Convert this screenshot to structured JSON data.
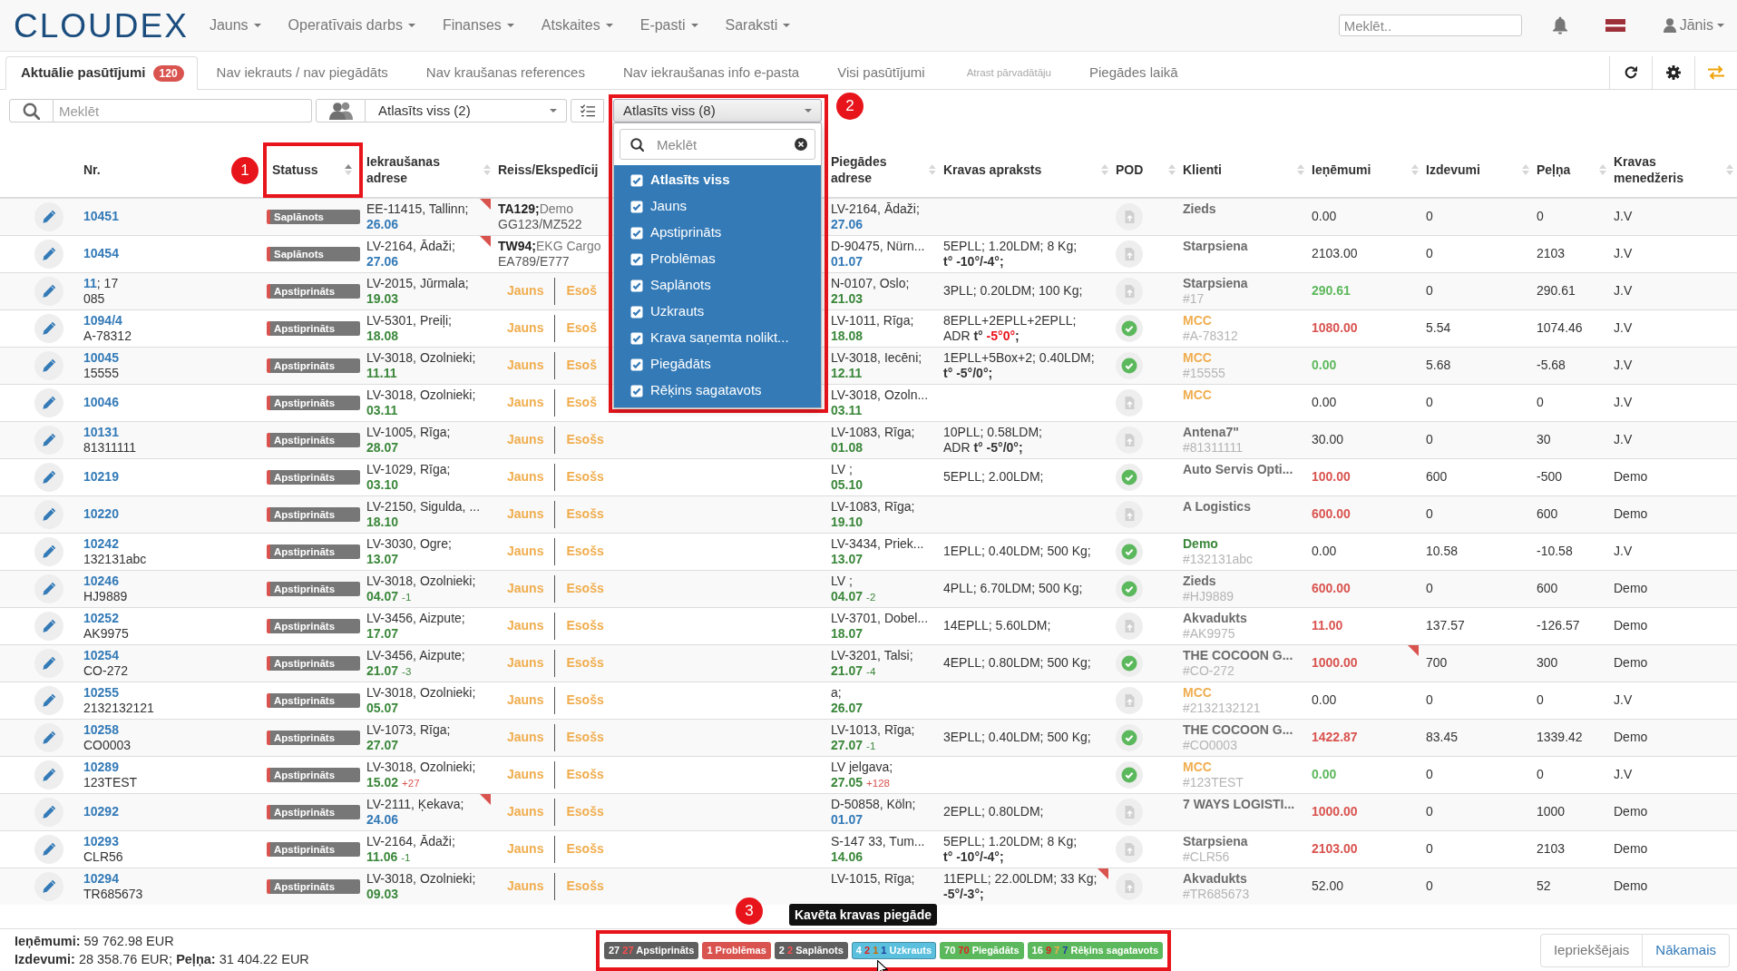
{
  "navbar": {
    "logo": "CLOUDEX",
    "menu": [
      {
        "label": "Jauns"
      },
      {
        "label": "Operatīvais darbs"
      },
      {
        "label": "Finanses"
      },
      {
        "label": "Atskaites"
      },
      {
        "label": "E-pasti"
      },
      {
        "label": "Saraksti"
      }
    ],
    "search": {
      "placeholder": "Meklēt.."
    },
    "user": "Jānis"
  },
  "tabs": [
    {
      "label": "Aktuālie pasūtījumi",
      "count": "120",
      "selected": true,
      "disabled": false
    },
    {
      "label": "Nav iekrauts / nav piegādāts",
      "selected": false,
      "disabled": false
    },
    {
      "label": "Nav kraušanas references",
      "selected": false,
      "disabled": false
    },
    {
      "label": "Nav iekraušanas info e-pasta",
      "selected": false,
      "disabled": false
    },
    {
      "label": "Visi pasūtījumi",
      "selected": false,
      "disabled": false
    },
    {
      "label": "Atrast pārvadātāju",
      "selected": false,
      "disabled": true
    },
    {
      "label": "Piegādes laikā",
      "selected": false,
      "disabled": false
    }
  ],
  "filters": {
    "search": {
      "placeholder": "Meklēt"
    },
    "group_select": {
      "value": "Atlasīts viss (2)"
    },
    "status_select": {
      "value": "Atlasīts viss (8)",
      "expanded": true,
      "search_placeholder": "Meklēt",
      "options": [
        {
          "kind": "all",
          "label": "Atlasīts viss",
          "checked": true
        },
        {
          "kind": "option",
          "label": "Jauns",
          "checked": true
        },
        {
          "kind": "option",
          "label": "Apstiprināts",
          "checked": true
        },
        {
          "kind": "option",
          "label": "Problēmas",
          "checked": true
        },
        {
          "kind": "option",
          "label": "Saplānots",
          "checked": true
        },
        {
          "kind": "option",
          "label": "Uzkrauts",
          "checked": true
        },
        {
          "kind": "option",
          "label": "Krava saņemta nolikt...",
          "checked": true
        },
        {
          "kind": "option",
          "label": "Piegādāts",
          "checked": true
        },
        {
          "kind": "option",
          "label": "Rēķins sagatavots",
          "checked": true
        }
      ]
    }
  },
  "table": {
    "columns": [
      {
        "label": "Nr."
      },
      {
        "label": "Statuss",
        "sorted": true
      },
      {
        "label": "Iekraušanas adrese",
        "sorted": false
      },
      {
        "label": "Reiss/Ekspedīcij"
      },
      {
        "label": "Piegādes adrese",
        "sorted": false
      },
      {
        "label": "Kravas apraksts",
        "sorted": false
      },
      {
        "label": "POD",
        "sorted": false
      },
      {
        "label": "Klienti",
        "sorted": false
      },
      {
        "label": "Ieņēmumi",
        "sorted": false
      },
      {
        "label": "Izdevumi",
        "sorted": false
      },
      {
        "label": "Peļņa",
        "sorted": false
      },
      {
        "label": "Kravas menedžeris",
        "sorted": false
      }
    ],
    "rows": [
      {
        "number": "10451",
        "status": "Saplānots",
        "loading": {
          "address": "EE-11415, Tallinn;",
          "date": "26.06",
          "color": "#337ab7"
        },
        "trip": {
          "kind": "assigned",
          "code": "TA129;",
          "carrier": "Demo",
          "vehicle": "GG123/MZ522"
        },
        "delivery": {
          "address": "LV-2164, Ādaži;",
          "date": "27.06",
          "color": "#337ab7"
        },
        "pod": false,
        "client": {
          "name": "Zieds",
          "color": "#6b6b6b"
        },
        "revenue": {
          "value": "0.00"
        },
        "expenses": "0",
        "profit": "0",
        "manager": "J.V",
        "flags": {
          "loading": true,
          "cargo": false,
          "revenue": false
        }
      },
      {
        "number": "10454",
        "status": "Saplānots",
        "loading": {
          "address": "LV-2164, Ādaži;",
          "date": "27.06",
          "color": "#337ab7"
        },
        "trip": {
          "kind": "assigned",
          "code": "TW94;",
          "carrier": "EKG Cargo",
          "vehicle": "EA789/E777"
        },
        "delivery": {
          "address": "D-90475, Nürn...",
          "date": "01.07",
          "color": "#337ab7"
        },
        "cargo": {
          "text": "5EPLL; 1.20LDM; 8 Kg;",
          "temperature": {
            "label": "t°",
            "value": "-10°/-4°",
            "end": ";",
            "alert": false
          }
        },
        "pod": false,
        "client": {
          "name": "Starpsiena",
          "color": "#6b6b6b"
        },
        "revenue": {
          "value": "2103.00"
        },
        "expenses": "0",
        "profit": "2103",
        "manager": "J.V",
        "flags": {
          "loading": true,
          "cargo": false,
          "revenue": false
        }
      },
      {
        "number": "11",
        "number_suffix": "; 17",
        "reference": "085",
        "status": "Apstiprināts",
        "loading": {
          "address": "LV-2015, Jūrmala;",
          "date": "19.03",
          "color": "#3a873a"
        },
        "trip": {
          "kind": "actions",
          "new": "Jauns",
          "existing": "Esoš"
        },
        "delivery": {
          "address": "N-0107, Oslo;",
          "date": "21.03",
          "color": "#3a873a"
        },
        "cargo": {
          "text": "3PLL; 0.20LDM; 100 Kg;"
        },
        "pod": false,
        "client": {
          "name": "Starpsiena",
          "color": "#6b6b6b",
          "code": "#17"
        },
        "revenue": {
          "value": "290.61",
          "color": "#5cb85c"
        },
        "expenses": "0",
        "profit": "290.61",
        "manager": "J.V",
        "flags": {
          "loading": false,
          "cargo": false,
          "revenue": false
        }
      },
      {
        "number": "1094/4",
        "reference": "A-78312",
        "status": "Apstiprināts",
        "loading": {
          "address": "LV-5301, Preiļi;",
          "date": "18.08",
          "color": "#3a873a"
        },
        "trip": {
          "kind": "actions",
          "new": "Jauns",
          "existing": "Esoš"
        },
        "delivery": {
          "address": "LV-1011, Rīga;",
          "date": "18.08",
          "color": "#3a873a"
        },
        "cargo": {
          "text": "8EPLL+2EPLL+2EPLL;",
          "temperature": {
            "prefix": "ADR",
            "label": "t°",
            "value": "-5°0°",
            "end": ";",
            "alert": true
          }
        },
        "pod": true,
        "client": {
          "name": "MCC",
          "color": "#f0ad4e",
          "code": "#A-78312"
        },
        "revenue": {
          "value": "1080.00",
          "color": "#d9534f"
        },
        "expenses": "5.54",
        "profit": "1074.46",
        "manager": "J.V",
        "flags": {
          "loading": false,
          "cargo": false,
          "revenue": false
        }
      },
      {
        "number": "10045",
        "reference": "15555",
        "status": "Apstiprināts",
        "loading": {
          "address": "LV-3018, Ozolnieki;",
          "date": "11.11",
          "color": "#3a873a"
        },
        "trip": {
          "kind": "actions",
          "new": "Jauns",
          "existing": "Esoš"
        },
        "delivery": {
          "address": "LV-3018, Iecēni;",
          "date": "12.11",
          "color": "#3a873a"
        },
        "cargo": {
          "text": "1EPLL+5Box+2; 0.40LDM;",
          "temperature": {
            "label": "t°",
            "value": "-5°/0°",
            "end": ";",
            "alert": false
          }
        },
        "pod": true,
        "client": {
          "name": "MCC",
          "color": "#f0ad4e",
          "code": "#15555"
        },
        "revenue": {
          "value": "0.00",
          "color": "#5cb85c"
        },
        "expenses": "5.68",
        "profit": "-5.68",
        "manager": "J.V",
        "flags": {
          "loading": false,
          "cargo": false,
          "revenue": false
        }
      },
      {
        "number": "10046",
        "status": "Apstiprināts",
        "loading": {
          "address": "LV-3018, Ozolnieki;",
          "date": "03.11",
          "color": "#3a873a"
        },
        "trip": {
          "kind": "actions",
          "new": "Jauns",
          "existing": "Esoš"
        },
        "delivery": {
          "address": "LV-3018, Ozoln...",
          "date": "03.11",
          "color": "#3a873a"
        },
        "pod": false,
        "client": {
          "name": "MCC",
          "color": "#f0ad4e"
        },
        "revenue": {
          "value": "0.00"
        },
        "expenses": "0",
        "profit": "0",
        "manager": "J.V",
        "flags": {
          "loading": false,
          "cargo": false,
          "revenue": false
        }
      },
      {
        "number": "10131",
        "reference": "81311111",
        "status": "Apstiprināts",
        "loading": {
          "address": "LV-1005, Rīga;",
          "date": "28.07",
          "color": "#3a873a"
        },
        "trip": {
          "kind": "actions",
          "new": "Jauns",
          "existing": "Esošs"
        },
        "delivery": {
          "address": "LV-1083, Rīga;",
          "date": "01.08",
          "color": "#3a873a"
        },
        "cargo": {
          "text": "10PLL; 0.58LDM;",
          "temperature": {
            "prefix": "ADR",
            "label": "t°",
            "value": "-5°/0°",
            "end": ";",
            "alert": false
          }
        },
        "pod": false,
        "client": {
          "name": "Antena7\"",
          "color": "#6b6b6b",
          "code": "#81311111"
        },
        "revenue": {
          "value": "30.00"
        },
        "expenses": "0",
        "profit": "30",
        "manager": "J.V",
        "flags": {
          "loading": false,
          "cargo": false,
          "revenue": false
        }
      },
      {
        "number": "10219",
        "status": "Apstiprināts",
        "loading": {
          "address": "LV-1029, Rīga;",
          "date": "03.10",
          "color": "#3a873a"
        },
        "trip": {
          "kind": "actions",
          "new": "Jauns",
          "existing": "Esošs"
        },
        "delivery": {
          "address": "LV ;",
          "date": "05.10",
          "color": "#3a873a"
        },
        "cargo": {
          "text": "5EPLL; 2.00LDM;"
        },
        "pod": true,
        "client": {
          "name": "Auto Servis Opti...",
          "color": "#6b6b6b"
        },
        "revenue": {
          "value": "100.00",
          "color": "#d9534f"
        },
        "expenses": "600",
        "profit": "-500",
        "manager": "Demo",
        "flags": {
          "loading": false,
          "cargo": false,
          "revenue": false
        }
      },
      {
        "number": "10220",
        "status": "Apstiprināts",
        "loading": {
          "address": "LV-2150, Sigulda, ...",
          "date": "18.10",
          "color": "#3a873a"
        },
        "trip": {
          "kind": "actions",
          "new": "Jauns",
          "existing": "Esošs"
        },
        "delivery": {
          "address": "LV-1083, Rīga;",
          "date": "19.10",
          "color": "#3a873a"
        },
        "pod": false,
        "client": {
          "name": "A Logistics",
          "color": "#6b6b6b"
        },
        "revenue": {
          "value": "600.00",
          "color": "#d9534f"
        },
        "expenses": "0",
        "profit": "600",
        "manager": "Demo",
        "flags": {
          "loading": false,
          "cargo": false,
          "revenue": false
        }
      },
      {
        "number": "10242",
        "reference": "132131abc",
        "status": "Apstiprināts",
        "loading": {
          "address": "LV-3030, Ogre;",
          "date": "13.07",
          "color": "#3a873a"
        },
        "trip": {
          "kind": "actions",
          "new": "Jauns",
          "existing": "Esošs"
        },
        "delivery": {
          "address": "LV-3434, Priek...",
          "date": "13.07",
          "color": "#3a873a"
        },
        "cargo": {
          "text": "1EPLL; 0.40LDM; 500 Kg;"
        },
        "pod": true,
        "client": {
          "name": "Demo",
          "color": "#3a873a",
          "code": "#132131abc"
        },
        "revenue": {
          "value": "0.00"
        },
        "expenses": "10.58",
        "profit": "-10.58",
        "manager": "J.V",
        "flags": {
          "loading": false,
          "cargo": false,
          "revenue": false
        }
      },
      {
        "number": "10246",
        "reference": "HJ9889",
        "status": "Apstiprināts",
        "loading": {
          "address": "LV-3018, Ozolnieki;",
          "date": "04.07",
          "color": "#3a873a",
          "offset": {
            "text": "-1",
            "late": false
          }
        },
        "trip": {
          "kind": "actions",
          "new": "Jauns",
          "existing": "Esošs"
        },
        "delivery": {
          "address": "LV ;",
          "date": "04.07",
          "color": "#3a873a",
          "offset": {
            "text": "-2",
            "late": false
          }
        },
        "cargo": {
          "text": "4PLL; 6.70LDM; 500 Kg;"
        },
        "pod": true,
        "client": {
          "name": "Zieds",
          "color": "#6b6b6b",
          "code": "#HJ9889"
        },
        "revenue": {
          "value": "600.00",
          "color": "#d9534f"
        },
        "expenses": "0",
        "profit": "600",
        "manager": "Demo",
        "flags": {
          "loading": false,
          "cargo": false,
          "revenue": false
        }
      },
      {
        "number": "10252",
        "reference": "AK9975",
        "status": "Apstiprināts",
        "loading": {
          "address": "LV-3456, Aizpute;",
          "date": "17.07",
          "color": "#3a873a"
        },
        "trip": {
          "kind": "actions",
          "new": "Jauns",
          "existing": "Esošs"
        },
        "delivery": {
          "address": "LV-3701, Dobel...",
          "date": "18.07",
          "color": "#3a873a"
        },
        "cargo": {
          "text": "14EPLL; 5.60LDM;"
        },
        "pod": false,
        "client": {
          "name": "Akvadukts",
          "color": "#6b6b6b",
          "code": "#AK9975"
        },
        "revenue": {
          "value": "11.00",
          "color": "#d9534f"
        },
        "expenses": "137.57",
        "profit": "-126.57",
        "manager": "Demo",
        "flags": {
          "loading": false,
          "cargo": false,
          "revenue": false
        }
      },
      {
        "number": "10254",
        "reference": "CO-272",
        "status": "Apstiprināts",
        "loading": {
          "address": "LV-3456, Aizpute;",
          "date": "21.07",
          "color": "#3a873a",
          "offset": {
            "text": "-3",
            "late": false
          }
        },
        "trip": {
          "kind": "actions",
          "new": "Jauns",
          "existing": "Esošs"
        },
        "delivery": {
          "address": "LV-3201, Talsi;",
          "date": "21.07",
          "color": "#3a873a",
          "offset": {
            "text": "-4",
            "late": false
          }
        },
        "cargo": {
          "text": "4EPLL; 0.80LDM; 500 Kg;"
        },
        "pod": true,
        "client": {
          "name": "THE COCOON G...",
          "color": "#6b6b6b",
          "code": "#CO-272"
        },
        "revenue": {
          "value": "1000.00",
          "color": "#d9534f"
        },
        "expenses": "700",
        "profit": "300",
        "manager": "Demo",
        "flags": {
          "loading": false,
          "cargo": false,
          "revenue": true
        }
      },
      {
        "number": "10255",
        "reference": "2132132121",
        "status": "Apstiprināts",
        "loading": {
          "address": "LV-3018, Ozolnieki;",
          "date": "05.07",
          "color": "#3a873a"
        },
        "trip": {
          "kind": "actions",
          "new": "Jauns",
          "existing": "Esošs"
        },
        "delivery": {
          "address": "a;",
          "date": "26.07",
          "color": "#3a873a"
        },
        "pod": false,
        "client": {
          "name": "MCC",
          "color": "#f0ad4e",
          "code": "#2132132121"
        },
        "revenue": {
          "value": "0.00"
        },
        "expenses": "0",
        "profit": "0",
        "manager": "J.V",
        "flags": {
          "loading": false,
          "cargo": false,
          "revenue": false
        }
      },
      {
        "number": "10258",
        "reference": "CO0003",
        "status": "Apstiprināts",
        "loading": {
          "address": "LV-1073, Rīga;",
          "date": "27.07",
          "color": "#3a873a"
        },
        "trip": {
          "kind": "actions",
          "new": "Jauns",
          "existing": "Esošs"
        },
        "delivery": {
          "address": "LV-1013, Rīga;",
          "date": "27.07",
          "color": "#3a873a",
          "offset": {
            "text": "-1",
            "late": false
          }
        },
        "cargo": {
          "text": "3EPLL; 0.40LDM; 500 Kg;"
        },
        "pod": true,
        "client": {
          "name": "THE COCOON G...",
          "color": "#6b6b6b",
          "code": "#CO0003"
        },
        "revenue": {
          "value": "1422.87",
          "color": "#d9534f"
        },
        "expenses": "83.45",
        "profit": "1339.42",
        "manager": "Demo",
        "flags": {
          "loading": false,
          "cargo": false,
          "revenue": false
        }
      },
      {
        "number": "10289",
        "reference": "123TEST",
        "status": "Apstiprināts",
        "loading": {
          "address": "LV-3018, Ozolnieki;",
          "date": "15.02",
          "color": "#3a873a",
          "offset": {
            "text": "+27",
            "late": true
          }
        },
        "trip": {
          "kind": "actions",
          "new": "Jauns",
          "existing": "Esošs"
        },
        "delivery": {
          "address": "LV jelgava;",
          "date": "27.05",
          "color": "#3a873a",
          "offset": {
            "text": "+128",
            "late": true
          }
        },
        "pod": true,
        "client": {
          "name": "MCC",
          "color": "#f0ad4e",
          "code": "#123TEST"
        },
        "revenue": {
          "value": "0.00",
          "color": "#5cb85c"
        },
        "expenses": "0",
        "profit": "0",
        "manager": "J.V",
        "flags": {
          "loading": false,
          "cargo": false,
          "revenue": false
        }
      },
      {
        "number": "10292",
        "status": "Apstiprināts",
        "loading": {
          "address": "LV-2111, Ķekava;",
          "date": "24.06",
          "color": "#337ab7"
        },
        "trip": {
          "kind": "actions",
          "new": "Jauns",
          "existing": "Esošs"
        },
        "delivery": {
          "address": "D-50858, Köln;",
          "date": "01.07",
          "color": "#337ab7"
        },
        "cargo": {
          "text": "2EPLL; 0.80LDM;"
        },
        "pod": false,
        "client": {
          "name": "7 WAYS LOGISTI...",
          "color": "#6b6b6b"
        },
        "revenue": {
          "value": "1000.00",
          "color": "#d9534f"
        },
        "expenses": "0",
        "profit": "1000",
        "manager": "Demo",
        "flags": {
          "loading": true,
          "cargo": false,
          "revenue": false
        }
      },
      {
        "number": "10293",
        "reference": "CLR56",
        "status": "Apstiprināts",
        "loading": {
          "address": "LV-2164, Ādaži;",
          "date": "11.06",
          "color": "#3a873a",
          "offset": {
            "text": "-1",
            "late": false
          }
        },
        "trip": {
          "kind": "actions",
          "new": "Jauns",
          "existing": "Esošs"
        },
        "delivery": {
          "address": "S-147 33, Tum...",
          "date": "14.06",
          "color": "#3a873a"
        },
        "cargo": {
          "text": "5EPLL; 1.20LDM; 8 Kg;",
          "temperature": {
            "label": "t°",
            "value": "-10°/-4°",
            "end": ";",
            "alert": false
          }
        },
        "pod": false,
        "client": {
          "name": "Starpsiena",
          "color": "#6b6b6b",
          "code": "#CLR56"
        },
        "revenue": {
          "value": "2103.00",
          "color": "#d9534f"
        },
        "expenses": "0",
        "profit": "2103",
        "manager": "Demo",
        "flags": {
          "loading": false,
          "cargo": false,
          "revenue": false
        }
      },
      {
        "number": "10294",
        "reference": "TR685673",
        "status": "Apstiprināts",
        "loading": {
          "address": "LV-3018, Ozolnieki;",
          "date": "09.03",
          "color": "#3a873a"
        },
        "trip": {
          "kind": "actions",
          "new": "Jauns",
          "existing": "Esošs"
        },
        "delivery": {
          "address": "LV-1015, Rīga;"
        },
        "cargo": {
          "text": "11EPLL; 22.00LDM; 33 Kg;",
          "temperature": {
            "value": "-5°/-3°",
            "end": ";",
            "alert": false
          }
        },
        "pod": false,
        "client": {
          "name": "Akvadukts",
          "color": "#6b6b6b",
          "code": "#TR685673"
        },
        "revenue": {
          "value": "52.00"
        },
        "expenses": "0",
        "profit": "52",
        "manager": "Demo",
        "flags": {
          "loading": false,
          "cargo": true,
          "revenue": false
        }
      }
    ]
  },
  "footer": {
    "totals": [
      "**Ieņēmumi:** 59 762.98 EUR",
      "**Izdevumi:** 28 358.76 EUR; **Peļņa:** 31 404.22 EUR"
    ],
    "status_counts": [
      {
        "label": "Apstiprināts",
        "color": "#5f5f5f",
        "hovered": false,
        "counts": [
          {
            "value": "27",
            "color": "#ffffff"
          },
          {
            "value": "27",
            "color": "#ff4d4d"
          }
        ]
      },
      {
        "label": "Problēmas",
        "color": "#d9534f",
        "hovered": false,
        "counts": [
          {
            "value": "1",
            "color": "#ffffff"
          }
        ]
      },
      {
        "label": "Saplānots",
        "color": "#5f5f5f",
        "hovered": false,
        "counts": [
          {
            "value": "2",
            "color": "#ffffff"
          },
          {
            "value": "2",
            "color": "#ff4d4d"
          }
        ]
      },
      {
        "label": "Uzkrauts",
        "color": "#5bc0de",
        "hovered": true,
        "counts": [
          {
            "value": "4",
            "color": "#ffffff"
          },
          {
            "value": "2",
            "color": "#e0201f"
          },
          {
            "value": "1",
            "color": "#cc6a00"
          },
          {
            "value": "1",
            "color": "#1f3f9c"
          }
        ]
      },
      {
        "label": "Piegādāts",
        "color": "#5cb85c",
        "hovered": false,
        "counts": [
          {
            "value": "70",
            "color": "#ffffff"
          },
          {
            "value": "70",
            "color": "#e0201f"
          }
        ]
      },
      {
        "label": "Rēķins sagatavots",
        "color": "#5cb85c",
        "hovered": false,
        "counts": [
          {
            "value": "16",
            "color": "#ffffff"
          },
          {
            "value": "9",
            "color": "#e0201f"
          },
          {
            "value": "7",
            "color": "#f0ad4e"
          },
          {
            "value": "7",
            "color": "#1f3f9c"
          }
        ]
      }
    ],
    "tooltip": "Kavēta kravas piegāde",
    "pagination": [
      {
        "label": "Iepriekšējais",
        "disabled": true
      },
      {
        "label": "Nākamais",
        "disabled": false
      }
    ]
  },
  "annotations": [
    {
      "number": "1"
    },
    {
      "number": "2"
    },
    {
      "number": "3"
    }
  ]
}
